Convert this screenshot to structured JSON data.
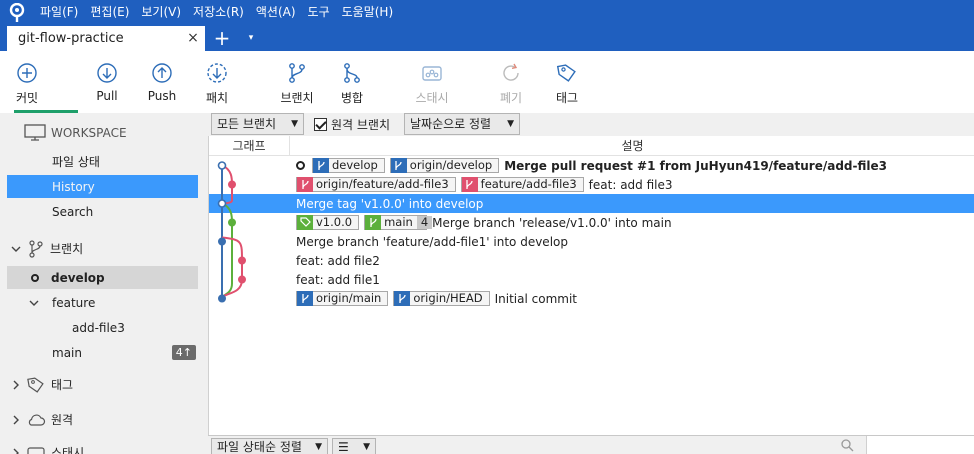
{
  "menu": [
    "파일(F)",
    "편집(E)",
    "보기(V)",
    "저장소(R)",
    "액션(A)",
    "도구",
    "도움말(H)"
  ],
  "tab": {
    "title": "git-flow-practice",
    "close": "×",
    "new_tab": "+",
    "dropdown": "▾"
  },
  "toolbar": {
    "commit": "커밋",
    "pull": "Pull",
    "push": "Push",
    "fetch": "패치",
    "branch": "브랜치",
    "merge": "병합",
    "stash": "스태시",
    "discard": "폐기",
    "tag": "태그"
  },
  "sidebar": {
    "workspace": "WORKSPACE",
    "file_status": "파일 상태",
    "history": "History",
    "search": "Search",
    "branches": "브랜치",
    "develop": "develop",
    "feature": "feature",
    "add_file3": "add-file3",
    "main": "main",
    "main_badge": "4↑",
    "tags": "태그",
    "remotes": "원격",
    "stash": "스태시"
  },
  "filters": {
    "all_branches": "모든 브랜치",
    "remote_branches": "원격 브랜치",
    "remote_checked": true,
    "sort": "날짜순으로 정렬"
  },
  "columns": {
    "graph": "그래프",
    "description": "설명"
  },
  "commits": [
    {
      "refs": [
        {
          "name": "develop",
          "kind": "local"
        },
        {
          "name": "origin/develop",
          "kind": "local"
        }
      ],
      "subject": "Merge pull request #1 from JuHyun419/feature/add-file3",
      "bold": true,
      "head": true
    },
    {
      "refs": [
        {
          "name": "origin/feature/add-file3",
          "kind": "pink"
        },
        {
          "name": "feature/add-file3",
          "kind": "pink"
        }
      ],
      "subject": "feat: add file3"
    },
    {
      "refs": [],
      "subject": "Merge tag 'v1.0.0' into develop",
      "selected": true
    },
    {
      "refs": [
        {
          "name": "v1.0.0",
          "kind": "tag"
        },
        {
          "name": "main",
          "kind": "green",
          "count": "4"
        }
      ],
      "subject": "Merge branch 'release/v1.0.0' into main"
    },
    {
      "refs": [],
      "subject": "Merge branch 'feature/add-file1' into develop"
    },
    {
      "refs": [],
      "subject": "feat: add file2"
    },
    {
      "refs": [],
      "subject": "feat: add file1"
    },
    {
      "refs": [
        {
          "name": "origin/main",
          "kind": "local"
        },
        {
          "name": "origin/HEAD",
          "kind": "local"
        }
      ],
      "subject": "Initial commit"
    }
  ],
  "bottom": {
    "sort": "파일 상태순 정렬",
    "view": "☰"
  },
  "colors": {
    "menubar": "#1f5fbf",
    "selection": "#3b99fc",
    "graph_blue": "#3a6fb0",
    "graph_pink": "#e0506e",
    "graph_green": "#5cb03c",
    "ref_blue": "#2d6db8",
    "ref_pink": "#e0506e",
    "ref_green": "#5cb03c"
  }
}
